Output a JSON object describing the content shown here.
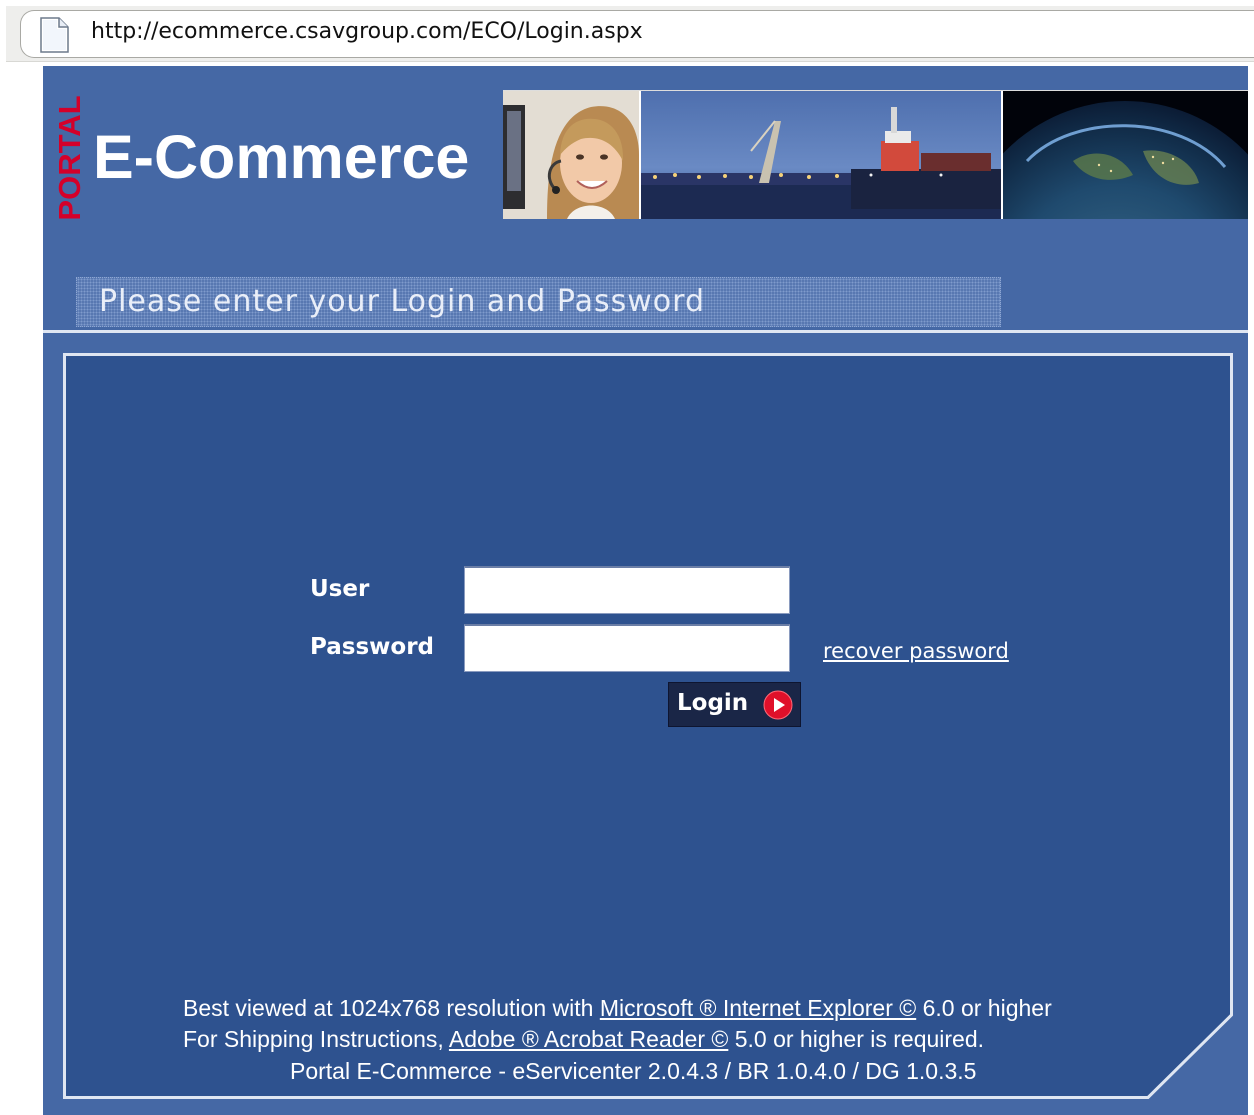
{
  "browser": {
    "url": "http://ecommerce.csavgroup.com/ECO/Login.aspx",
    "page_icon": "page-icon"
  },
  "header": {
    "portal_label": "PORTAL",
    "brand": "E-Commerce",
    "banner_images": [
      "customer-service-agent-photo",
      "container-port-photo",
      "earth-globe-photo"
    ],
    "prompt": "Please enter your Login and Password"
  },
  "form": {
    "user_label": "User",
    "user_value": "",
    "password_label": "Password",
    "password_value": "",
    "recover_link": "recover password",
    "login_button": "Login",
    "login_icon": "play-icon"
  },
  "footer": {
    "line1_prefix": "Best viewed at 1024x768 resolution with ",
    "line1_link": "Microsoft ® Internet Explorer ©",
    "line1_suffix": " 6.0 or higher",
    "line2_prefix": "For Shipping Instructions, ",
    "line2_link": "Adobe ® Acrobat Reader ©",
    "line2_suffix": " 5.0 or higher is required.",
    "line3": "Portal E-Commerce - eServicenter 2.0.4.3 / BR 1.0.4.0 / DG 1.0.3.5"
  },
  "colors": {
    "frame_blue": "#4568a5",
    "panel_blue": "#2e528f",
    "portal_red": "#d4002a",
    "button_navy": "#1a2647",
    "play_red": "#e0102a"
  }
}
